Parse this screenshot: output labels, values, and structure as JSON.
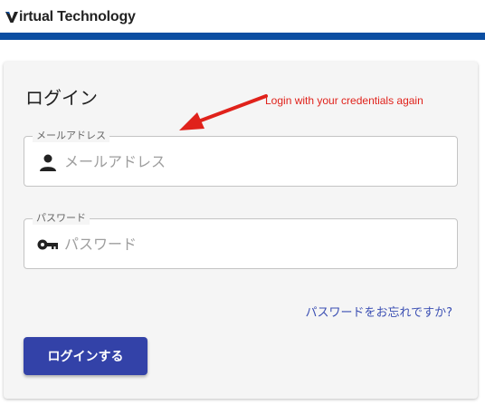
{
  "header": {
    "brand_name": "irtual Technology",
    "accent_color": "#0b4ea2"
  },
  "login_card": {
    "title": "ログイン",
    "annotation": "Login with your credentials again",
    "email": {
      "label": "メールアドレス",
      "placeholder": "メールアドレス",
      "icon": "person-icon"
    },
    "password": {
      "label": "パスワード",
      "placeholder": "パスワード",
      "icon": "key-icon"
    },
    "forgot_password": "パスワードをお忘れですか?",
    "submit_label": "ログインする",
    "button_color": "#3342a8",
    "annotation_color": "#e0221b"
  }
}
